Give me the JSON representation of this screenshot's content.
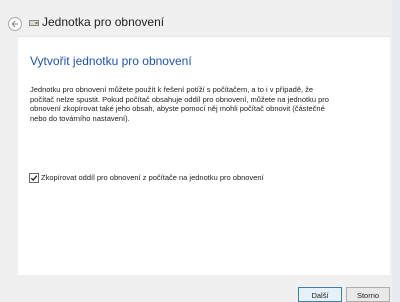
{
  "window": {
    "title": "Jednotka pro obnovení"
  },
  "main": {
    "heading": "Vytvořit jednotku pro obnovení",
    "description": "Jednotku pro obnovení můžete použít k řešení potíží s počítačem, a to i v případě, že počítač nelze spustit. Pokud počítač obsahuje oddíl pro obnovení, můžete na jednotku pro obnovení zkopírovat také jeho obsah, abyste pomocí něj mohli počítač obnovit (částečné nebo do továrního nastavení).",
    "checkbox": {
      "label": "Zkopírovat oddíl pro obnovení z počítače na jednotku pro obnovení",
      "checked": true
    }
  },
  "footer": {
    "next_label": "Další",
    "cancel_label": "Storno"
  },
  "icons": {
    "back": "back-arrow-icon",
    "app": "recovery-drive-icon",
    "check": "checkmark-icon"
  },
  "colors": {
    "heading": "#1e54a6",
    "window_bg": "#f0f0f0",
    "content_bg": "#ffffff"
  }
}
